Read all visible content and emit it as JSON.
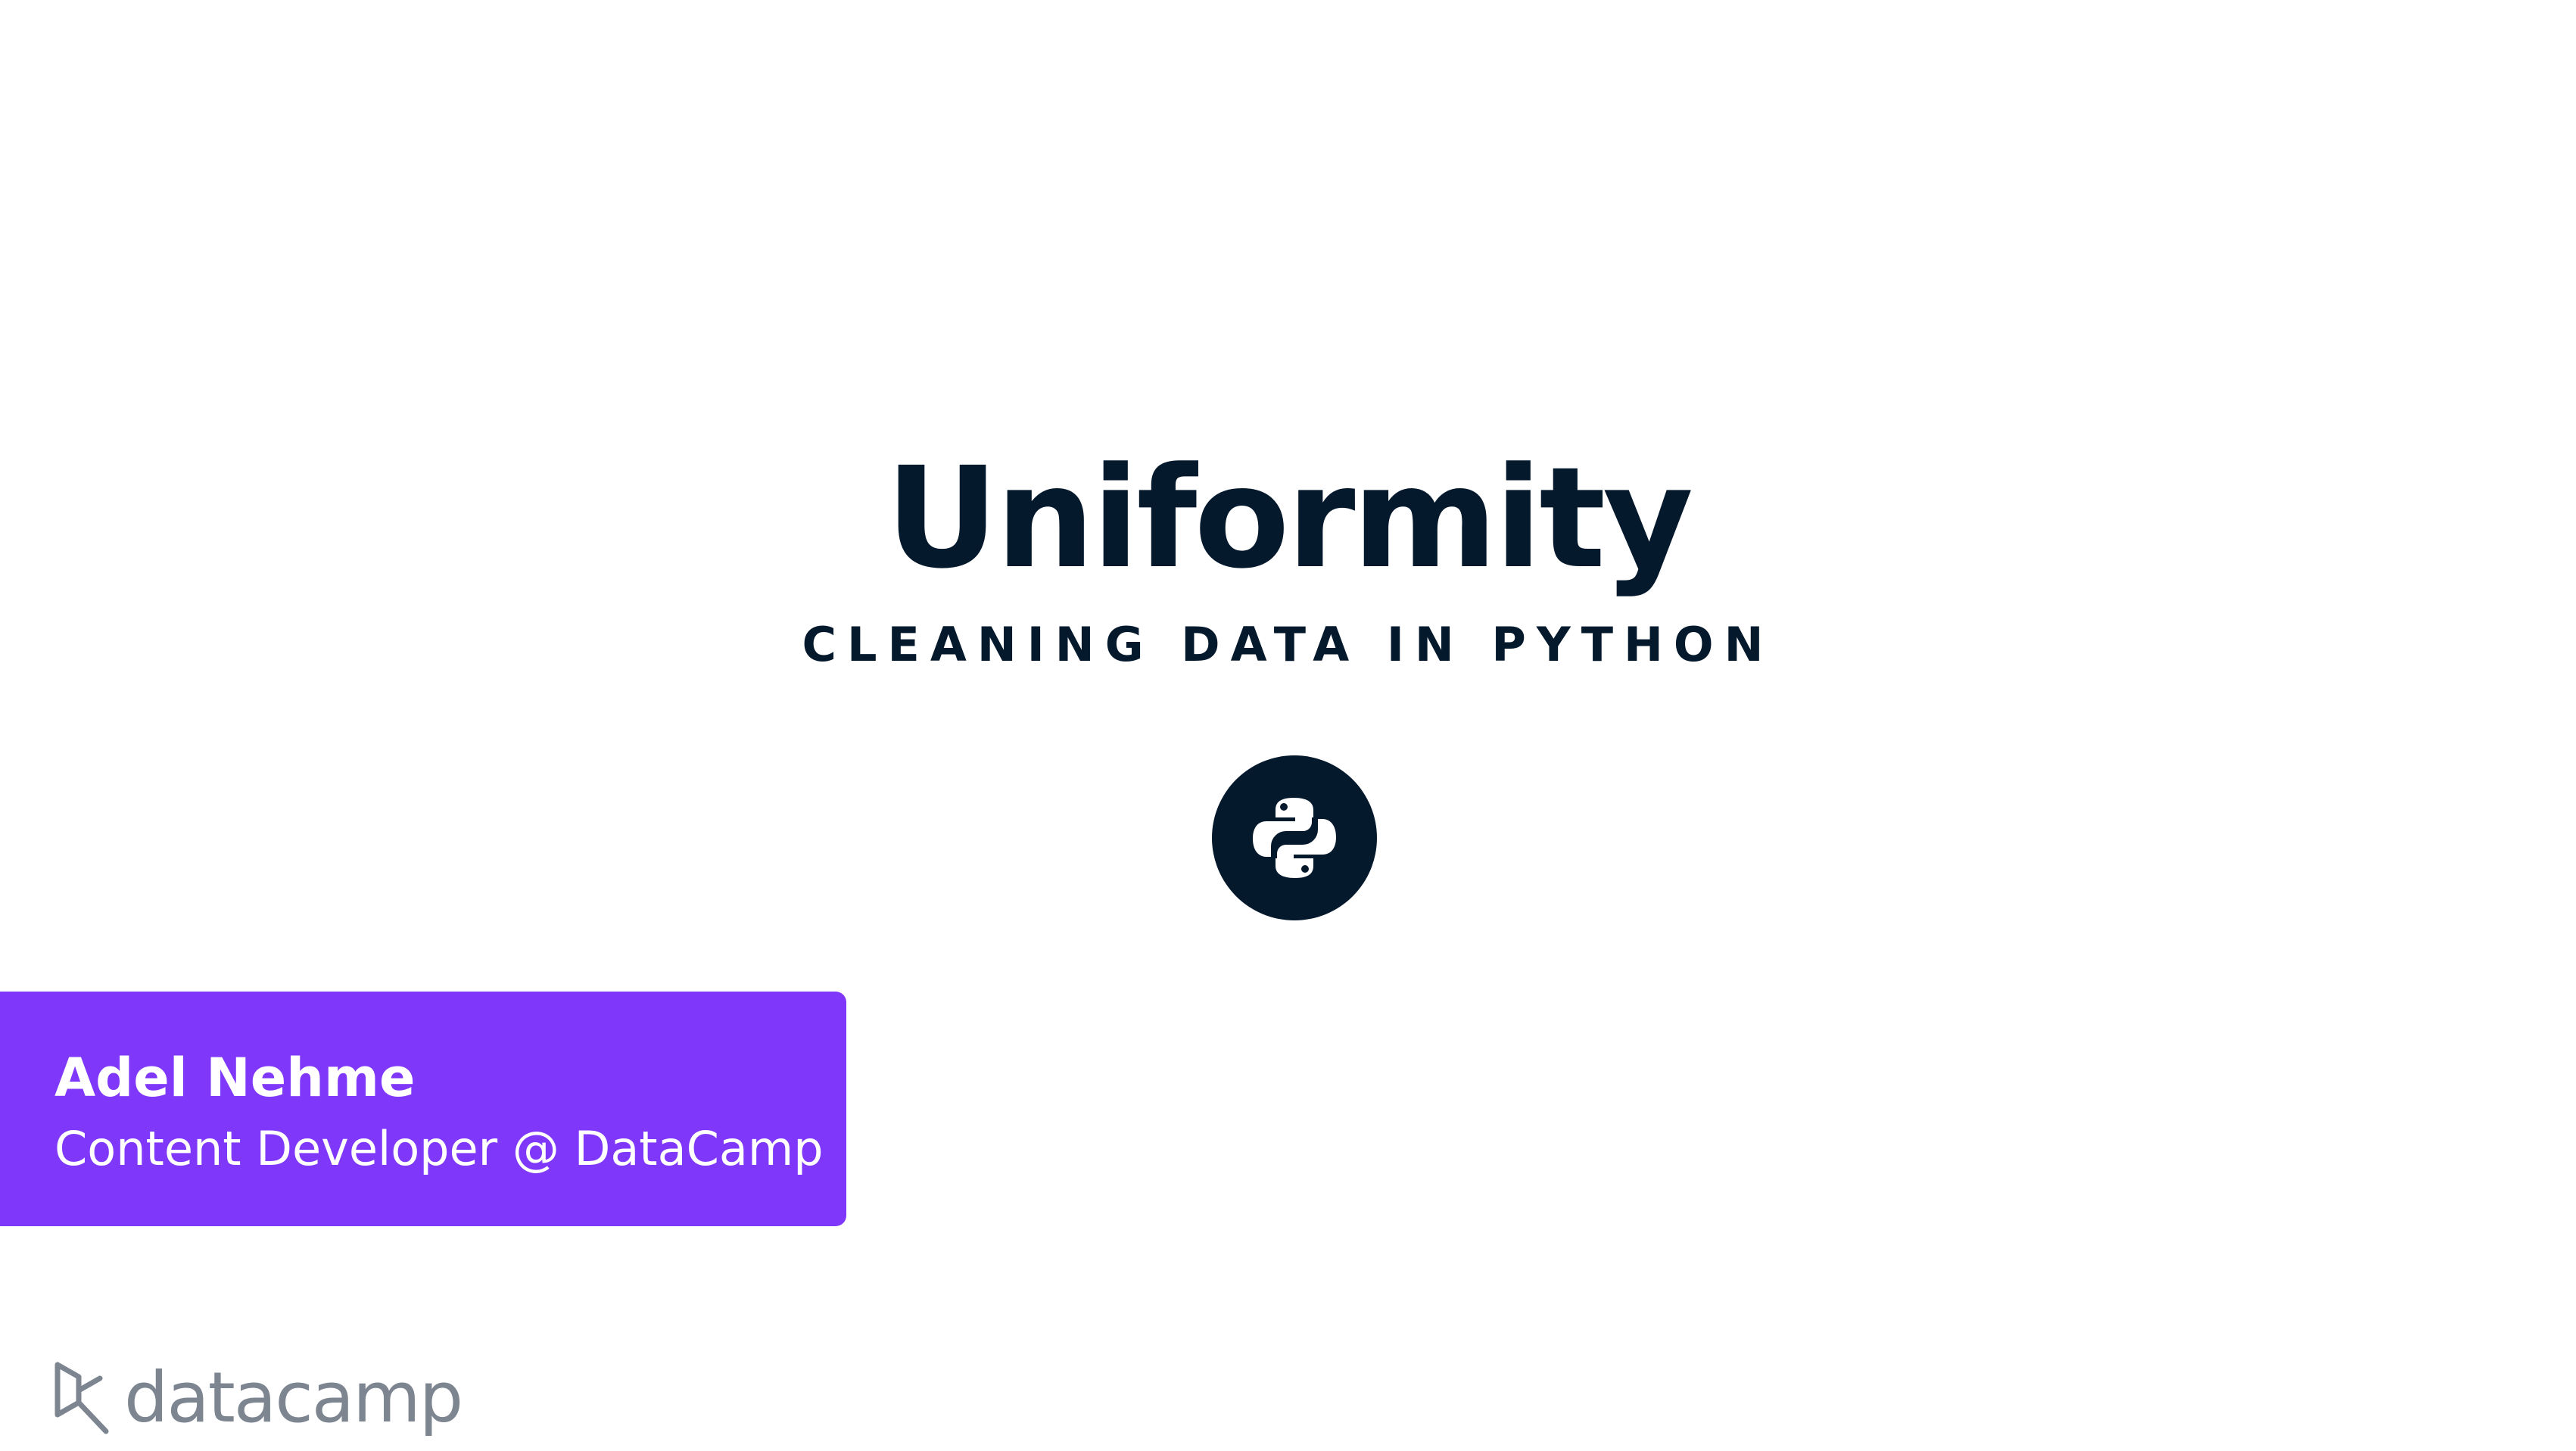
{
  "slide": {
    "title": "Uniformity",
    "course_name": "CLEANING DATA IN PYTHON",
    "course_icon": "python-logo-icon"
  },
  "author": {
    "name": "Adel Nehme",
    "role": "Content Developer @ DataCamp"
  },
  "brand": {
    "wordmark": "datacamp",
    "icon": "datacamp-logo-icon"
  },
  "colors": {
    "title_text": "#05192d",
    "icon_circle": "#05192d",
    "author_box": "#7f38f9",
    "brand_gray": "#7c8590",
    "background": "#ffffff"
  }
}
